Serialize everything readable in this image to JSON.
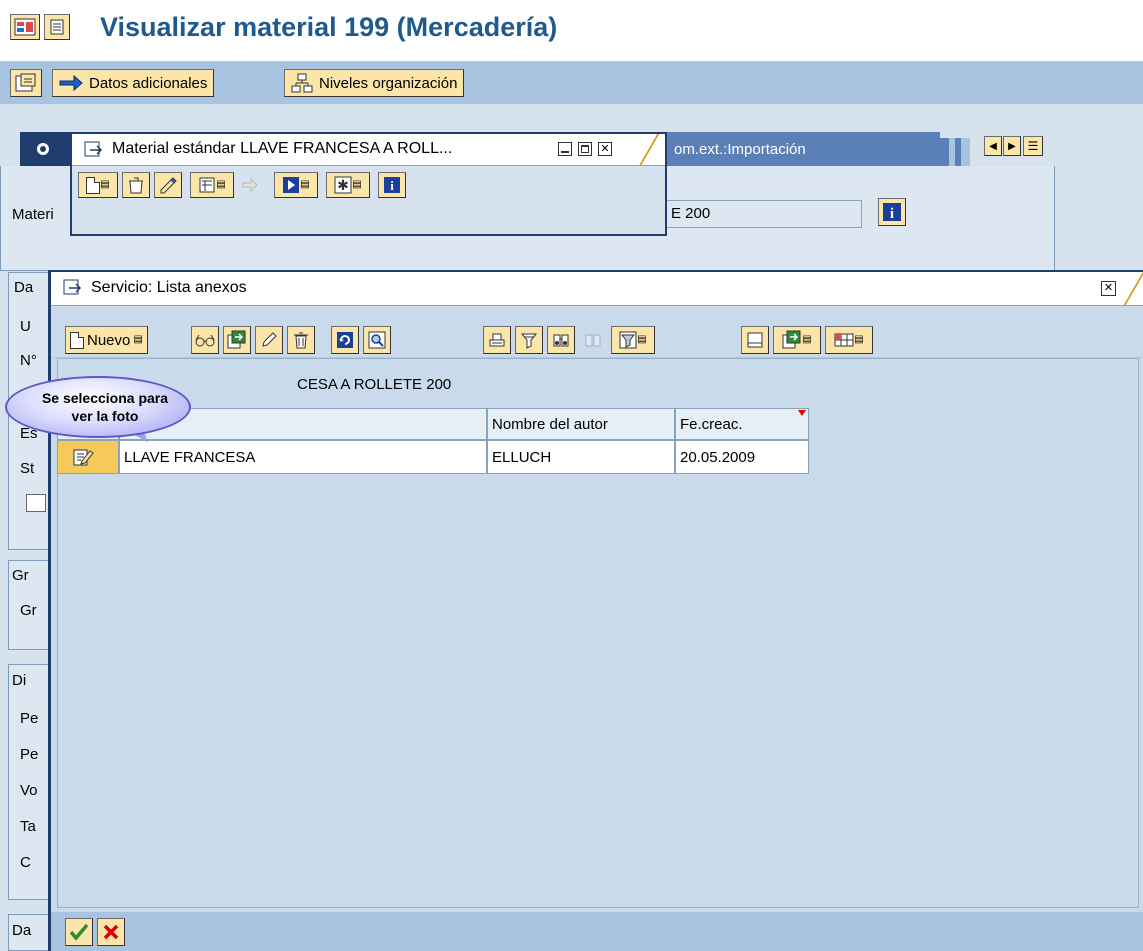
{
  "window": {
    "title": "Visualizar material 199 (Mercadería)"
  },
  "app_toolbar": {
    "additional_data_label": "Datos adicionales",
    "org_levels_label": "Niveles organización"
  },
  "background": {
    "tab_visible_text": "om.ext.:Importación",
    "material_label_fragment": "Materi",
    "material_value_fragment": "E 200",
    "side_labels": [
      "Da",
      "U",
      "N°",
      "Es",
      "St",
      "Gr",
      "Gr",
      "Di",
      "Pe",
      "Pe",
      "Vo",
      "Ta",
      "C",
      "Da"
    ]
  },
  "popup_material": {
    "title": "Material estándar  LLAVE FRANCESA A ROLL..."
  },
  "popup_attachments": {
    "title": "Servicio: Lista anexos",
    "toolbar": {
      "new_label": "Nuevo"
    },
    "object_text": "CESA A ROLLETE 200",
    "columns": [
      "Nombre del autor",
      "Fe.creac."
    ],
    "rows": [
      {
        "title": "LLAVE FRANCESA",
        "author": "ELLUCH",
        "date": "20.05.2009"
      }
    ]
  },
  "callout": {
    "text": "Se selecciona para ver la foto"
  },
  "colors": {
    "accent": "#1e5a8e",
    "button_bg": "#fbe5a8",
    "toolbar_bg": "#a8c3e0",
    "popup_border": "#1e3f6e"
  },
  "icons": [
    "layout-icon",
    "menu-icon",
    "screen-icon",
    "arrow-right-icon",
    "hierarchy-icon",
    "info-icon",
    "new-doc-icon",
    "glasses-icon",
    "export-icon",
    "pencil-icon",
    "trash-icon",
    "refresh-icon",
    "search-icon",
    "print-icon",
    "filter-icon",
    "binoculars-icon",
    "sum-icon",
    "filter-settings-icon",
    "sheet-icon",
    "grid-icon",
    "edit-doc-icon",
    "check-icon",
    "cancel-icon",
    "minimize-icon",
    "maximize-icon",
    "close-icon"
  ]
}
